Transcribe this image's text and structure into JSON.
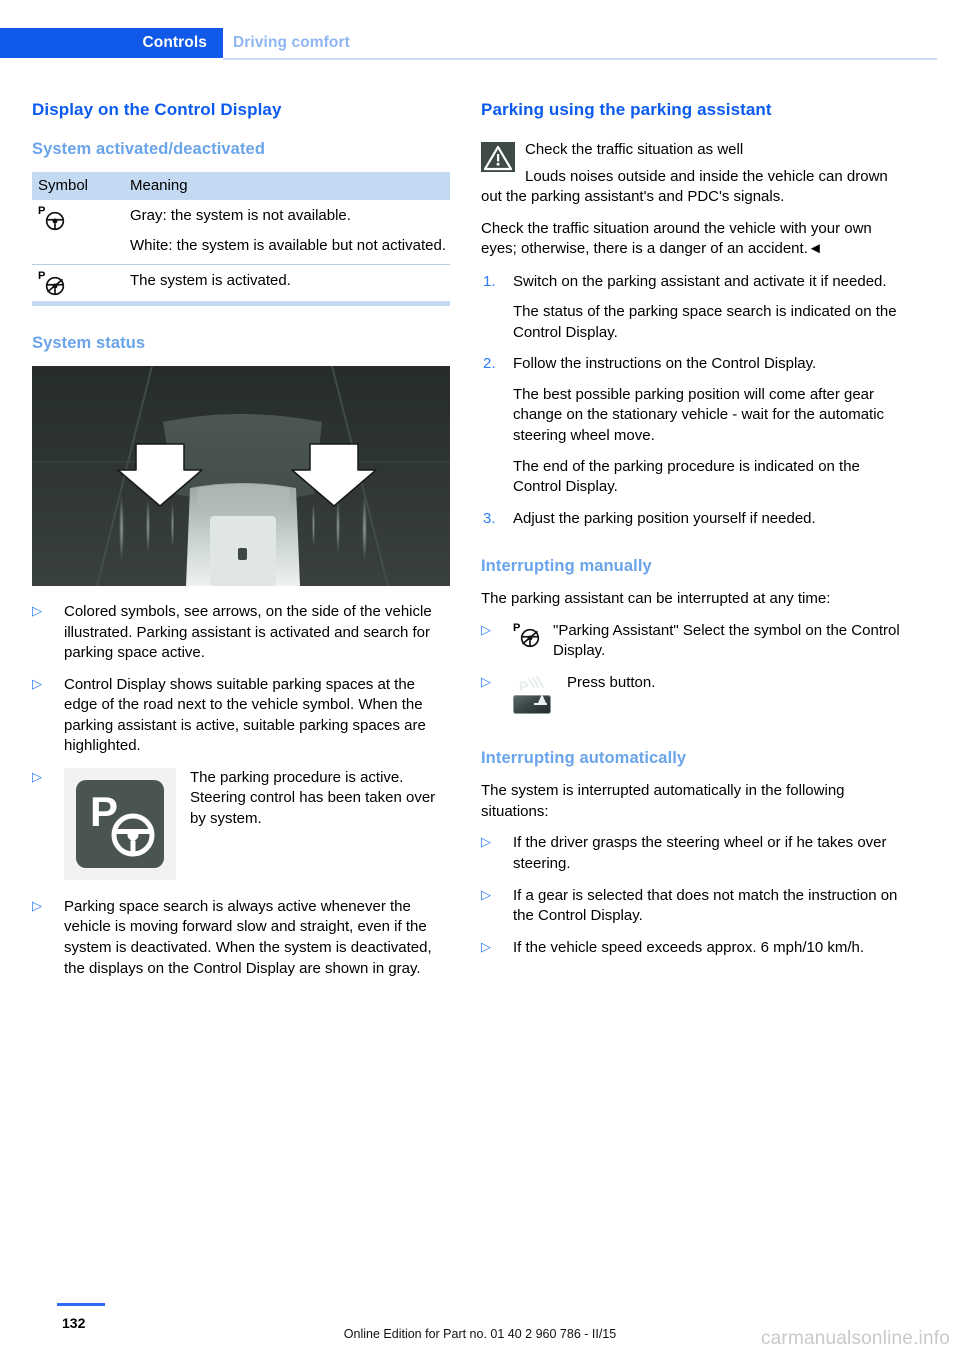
{
  "header": {
    "active_tab": "Controls",
    "inactive_tab": "Driving comfort",
    "active_bg": "#1159e8",
    "inactive_color": "#8fb5f2"
  },
  "colors": {
    "heading_blue": "#0b5bf0",
    "subheading_blue": "#6aa4ea",
    "bullet_blue": "#2d7dfa",
    "table_header_bg": "#c3daf2"
  },
  "left": {
    "title": "Display on the Control Display",
    "subtitle_1": "System activated/deactivated",
    "table": {
      "columns": [
        "Symbol",
        "Meaning"
      ],
      "rows": [
        {
          "symbol_icon": "parking-steering-wheel-icon",
          "meaning_lines": [
            "Gray: the system is not available.",
            "White: the system is available but not activated."
          ]
        },
        {
          "symbol_icon": "parking-steering-wheel-active-icon",
          "meaning_lines": [
            "The system is activated."
          ]
        }
      ]
    },
    "subtitle_2": "System status",
    "figure_alt": "Top-down view of vehicle with two white arrows pointing at parking space indicators",
    "bullets": [
      {
        "text": "Colored symbols, see arrows, on the side of the vehicle illustrated. Parking assistant is activated and search for parking space active."
      },
      {
        "text": "Control Display shows suitable parking spaces at the edge of the road next to the vehicle symbol. When the parking assistant is active, suitable parking spaces are highlighted."
      },
      {
        "icon": "parking-steering-wheel-tile-icon",
        "text": "The parking procedure is active. Steering control has been taken over by system."
      },
      {
        "text": "Parking space search is always active whenever the vehicle is moving forward slow and straight, even if the system is deactivated. When the system is deactivated, the displays on the Control Display are shown in gray."
      }
    ]
  },
  "right": {
    "title": "Parking using the parking assistant",
    "warning": {
      "icon": "warning-triangle-icon",
      "heading": "Check the traffic situation as well",
      "body": "Louds noises outside and inside the vehicle can drown out the parking assistant's and PDC's signals.",
      "body_2": "Check the traffic situation around the vehicle with your own eyes; otherwise, there is a danger of an accident.◄"
    },
    "steps": [
      {
        "number": "1.",
        "text": "Switch on the parking assistant and activate it if needed.",
        "note": "The status of the parking space search is indicated on the Control Display."
      },
      {
        "number": "2.",
        "text": "Follow the instructions on the Control Display.",
        "note": "The best possible parking position will come after gear change on the stationary vehicle - wait for the automatic steering wheel move.",
        "note_2": "The end of the parking procedure is indicated on the Control Display."
      },
      {
        "number": "3.",
        "text": "Adjust the parking position yourself if needed."
      }
    ],
    "subtitle_manual": "Interrupting manually",
    "manual_intro": "The parking assistant can be interrupted at any time:",
    "manual_bullets": [
      {
        "icon": "parking-steering-wheel-active-icon",
        "text": "\"Parking Assistant\" Select the symbol on the Control Display."
      },
      {
        "icon": "pdc-button-icon",
        "text": "Press button."
      }
    ],
    "subtitle_auto": "Interrupting automatically",
    "auto_intro": "The system is interrupted automatically in the following situations:",
    "auto_bullets": [
      "If the driver grasps the steering wheel or if he takes over steering.",
      "If a gear is selected that does not match the instruction on the Control Display.",
      "If the vehicle speed exceeds approx. 6 mph/10 km/h."
    ]
  },
  "footer": {
    "page_number": "132",
    "edition_note": "Online Edition for Part no. 01 40 2 960 786 - II/15",
    "watermark": "carmanualsonline.info"
  }
}
